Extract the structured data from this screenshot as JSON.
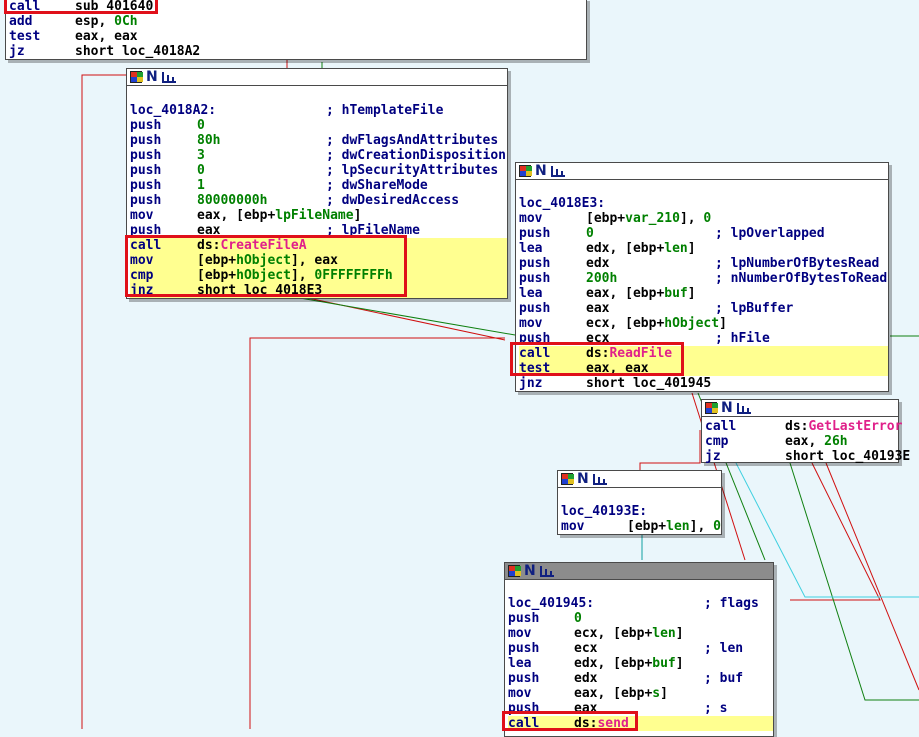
{
  "colors": {
    "background": "#eaf6fb",
    "highlight_box": "#e0101a",
    "api": "#e0208a",
    "number": "#008000",
    "text": "#000080"
  },
  "icons": [
    "block-color-grid-icon",
    "n-letter-icon",
    "graph-chart-icon"
  ],
  "nodes": [
    {
      "id": "n0",
      "lines": [
        {
          "m": "call",
          "o": [
            {
              "t": "sub_401640",
              "k": ""
            }
          ]
        },
        {
          "m": "add",
          "o": [
            {
              "t": "esp, ",
              "k": ""
            },
            {
              "t": "0Ch",
              "k": "num"
            }
          ]
        },
        {
          "m": "test",
          "o": [
            {
              "t": "eax, eax",
              "k": ""
            }
          ]
        },
        {
          "m": "jz",
          "o": [
            {
              "t": "short loc_4018A2",
              "k": ""
            }
          ]
        }
      ]
    },
    {
      "id": "n1",
      "label": "loc_4018A2:",
      "label_comment": "; hTemplateFile",
      "lines": [
        {
          "m": "push",
          "o": [
            {
              "t": "0",
              "k": "num"
            }
          ],
          "c": ""
        },
        {
          "m": "push",
          "o": [
            {
              "t": "80h",
              "k": "num"
            }
          ],
          "c": "; dwFlagsAndAttributes"
        },
        {
          "m": "push",
          "o": [
            {
              "t": "3",
              "k": "num"
            }
          ],
          "c": "; dwCreationDisposition"
        },
        {
          "m": "push",
          "o": [
            {
              "t": "0",
              "k": "num"
            }
          ],
          "c": "; lpSecurityAttributes"
        },
        {
          "m": "push",
          "o": [
            {
              "t": "1",
              "k": "num"
            }
          ],
          "c": "; dwShareMode"
        },
        {
          "m": "push",
          "o": [
            {
              "t": "80000000h",
              "k": "num"
            }
          ],
          "c": "; dwDesiredAccess"
        },
        {
          "m": "mov",
          "o": [
            {
              "t": "eax, [ebp+",
              "k": ""
            },
            {
              "t": "lpFileName",
              "k": "var"
            },
            {
              "t": "]",
              "k": ""
            }
          ],
          "c": ""
        },
        {
          "m": "push",
          "o": [
            {
              "t": "eax",
              "k": ""
            }
          ],
          "c": "; lpFileName"
        },
        {
          "m": "call",
          "o": [
            {
              "t": "ds:",
              "k": ""
            },
            {
              "t": "CreateFileA",
              "k": "api"
            }
          ],
          "c": ""
        },
        {
          "m": "mov",
          "o": [
            {
              "t": "[ebp+",
              "k": ""
            },
            {
              "t": "hObject",
              "k": "var"
            },
            {
              "t": "], eax",
              "k": ""
            }
          ],
          "c": ""
        },
        {
          "m": "cmp",
          "o": [
            {
              "t": "[ebp+",
              "k": ""
            },
            {
              "t": "hObject",
              "k": "var"
            },
            {
              "t": "], ",
              "k": ""
            },
            {
              "t": "0FFFFFFFFh",
              "k": "num"
            }
          ],
          "c": ""
        },
        {
          "m": "jnz",
          "o": [
            {
              "t": "short loc_4018E3",
              "k": ""
            }
          ],
          "c": ""
        }
      ]
    },
    {
      "id": "n2",
      "label": "loc_4018E3:",
      "label_comment": "",
      "lines": [
        {
          "m": "mov",
          "o": [
            {
              "t": "[ebp+",
              "k": ""
            },
            {
              "t": "var_210",
              "k": "var"
            },
            {
              "t": "], ",
              "k": ""
            },
            {
              "t": "0",
              "k": "num"
            }
          ],
          "c": ""
        },
        {
          "m": "push",
          "o": [
            {
              "t": "0",
              "k": "num"
            }
          ],
          "c": "; lpOverlapped"
        },
        {
          "m": "lea",
          "o": [
            {
              "t": "edx, [ebp+",
              "k": ""
            },
            {
              "t": "len",
              "k": "var"
            },
            {
              "t": "]",
              "k": ""
            }
          ],
          "c": ""
        },
        {
          "m": "push",
          "o": [
            {
              "t": "edx",
              "k": ""
            }
          ],
          "c": "; lpNumberOfBytesRead"
        },
        {
          "m": "push",
          "o": [
            {
              "t": "200h",
              "k": "num"
            }
          ],
          "c": "; nNumberOfBytesToRead"
        },
        {
          "m": "lea",
          "o": [
            {
              "t": "eax, [ebp+",
              "k": ""
            },
            {
              "t": "buf",
              "k": "var"
            },
            {
              "t": "]",
              "k": ""
            }
          ],
          "c": ""
        },
        {
          "m": "push",
          "o": [
            {
              "t": "eax",
              "k": ""
            }
          ],
          "c": "; lpBuffer"
        },
        {
          "m": "mov",
          "o": [
            {
              "t": "ecx, [ebp+",
              "k": ""
            },
            {
              "t": "hObject",
              "k": "var"
            },
            {
              "t": "]",
              "k": ""
            }
          ],
          "c": ""
        },
        {
          "m": "push",
          "o": [
            {
              "t": "ecx",
              "k": ""
            }
          ],
          "c": "; hFile"
        },
        {
          "m": "call",
          "o": [
            {
              "t": "ds:",
              "k": ""
            },
            {
              "t": "ReadFile",
              "k": "api"
            }
          ],
          "c": ""
        },
        {
          "m": "test",
          "o": [
            {
              "t": "eax, eax",
              "k": ""
            }
          ],
          "c": ""
        },
        {
          "m": "jnz",
          "o": [
            {
              "t": "short loc_401945",
              "k": ""
            }
          ],
          "c": ""
        }
      ]
    },
    {
      "id": "n3",
      "lines": [
        {
          "m": "call",
          "o": [
            {
              "t": "ds:",
              "k": ""
            },
            {
              "t": "GetLastError",
              "k": "api"
            }
          ],
          "c": ""
        },
        {
          "m": "cmp",
          "o": [
            {
              "t": "eax, ",
              "k": ""
            },
            {
              "t": "26h",
              "k": "num"
            }
          ],
          "c": ""
        },
        {
          "m": "jz",
          "o": [
            {
              "t": "short loc_40193E",
              "k": ""
            }
          ],
          "c": ""
        }
      ]
    },
    {
      "id": "n4",
      "label": "loc_40193E:",
      "label_comment": "",
      "lines": [
        {
          "m": "mov",
          "o": [
            {
              "t": "[ebp+",
              "k": ""
            },
            {
              "t": "len",
              "k": "var"
            },
            {
              "t": "], ",
              "k": ""
            },
            {
              "t": "0",
              "k": "num"
            }
          ],
          "c": ""
        }
      ]
    },
    {
      "id": "n5",
      "label": "loc_401945:",
      "label_comment": "; flags",
      "lines": [
        {
          "m": "push",
          "o": [
            {
              "t": "0",
              "k": "num"
            }
          ],
          "c": ""
        },
        {
          "m": "mov",
          "o": [
            {
              "t": "ecx, [ebp+",
              "k": ""
            },
            {
              "t": "len",
              "k": "var"
            },
            {
              "t": "]",
              "k": ""
            }
          ],
          "c": ""
        },
        {
          "m": "push",
          "o": [
            {
              "t": "ecx",
              "k": ""
            }
          ],
          "c": "; len"
        },
        {
          "m": "lea",
          "o": [
            {
              "t": "edx, [ebp+",
              "k": ""
            },
            {
              "t": "buf",
              "k": "var"
            },
            {
              "t": "]",
              "k": ""
            }
          ],
          "c": ""
        },
        {
          "m": "push",
          "o": [
            {
              "t": "edx",
              "k": ""
            }
          ],
          "c": "; buf"
        },
        {
          "m": "mov",
          "o": [
            {
              "t": "eax, [ebp+",
              "k": ""
            },
            {
              "t": "s",
              "k": "var"
            },
            {
              "t": "]",
              "k": ""
            }
          ],
          "c": ""
        },
        {
          "m": "push",
          "o": [
            {
              "t": "eax",
              "k": ""
            }
          ],
          "c": "; s"
        },
        {
          "m": "call",
          "o": [
            {
              "t": "ds:",
              "k": ""
            },
            {
              "t": "send",
              "k": "api"
            }
          ],
          "c": ""
        }
      ]
    }
  ]
}
